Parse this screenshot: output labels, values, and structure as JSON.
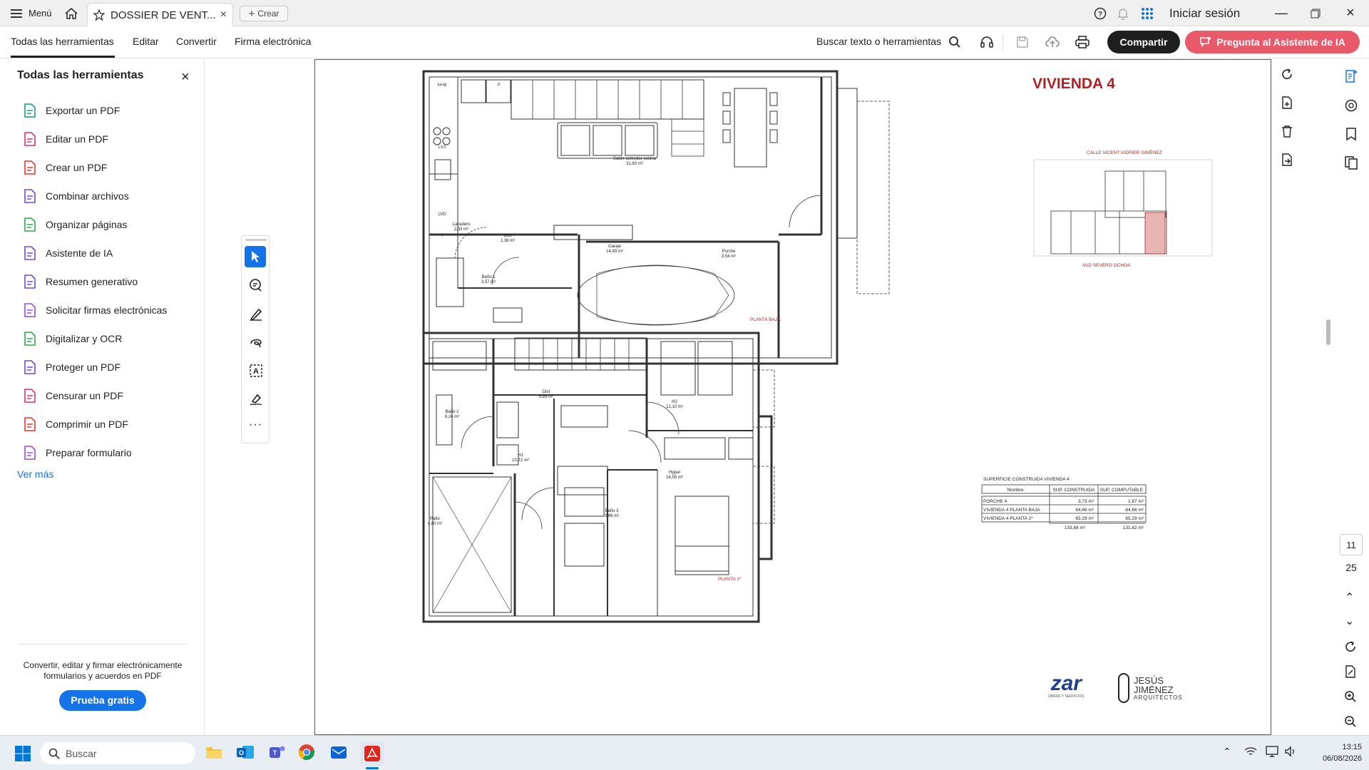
{
  "titlebar": {
    "menu_label": "Menú",
    "tab_title": "DOSSIER DE VENT...",
    "new_tab_label": "Crear",
    "signin_label": "Iniciar sesión"
  },
  "toolbar": {
    "menus": [
      "Todas las herramientas",
      "Editar",
      "Convertir",
      "Firma electrónica"
    ],
    "search_label": "Buscar texto o herramientas",
    "share_label": "Compartir",
    "ai_label": "Pregunta al Asistente de IA"
  },
  "left_panel": {
    "title": "Todas las herramientas",
    "tools": [
      {
        "label": "Exportar un PDF",
        "color": "#1a9c8a"
      },
      {
        "label": "Editar un PDF",
        "color": "#d6336c"
      },
      {
        "label": "Crear un PDF",
        "color": "#e03c31"
      },
      {
        "label": "Combinar archivos",
        "color": "#6b4bd8"
      },
      {
        "label": "Organizar páginas",
        "color": "#2fa84f"
      },
      {
        "label": "Asistente de IA",
        "color": "#6b4bd8"
      },
      {
        "label": "Resumen generativo",
        "color": "#6b4bd8"
      },
      {
        "label": "Solicitar firmas electrónicas",
        "color": "#9b4bd8"
      },
      {
        "label": "Digitalizar y OCR",
        "color": "#2fa84f"
      },
      {
        "label": "Proteger un PDF",
        "color": "#6b4bd8"
      },
      {
        "label": "Censurar un PDF",
        "color": "#d6336c"
      },
      {
        "label": "Comprimir un PDF",
        "color": "#e03c31"
      },
      {
        "label": "Preparar formulario",
        "color": "#9b4bd8"
      }
    ],
    "see_more": "Ver más",
    "promo_text": "Convertir, editar y firmar electrónicamente formularios y acuerdos en PDF",
    "trial_label": "Prueba gratis"
  },
  "document": {
    "title": "VIVIENDA 4",
    "street_top": "CALLE VICENT VIDRIER GIMÉNEZ",
    "street_bottom": "AVD SEVERO OCHOA",
    "ground_floor_label": "PLANTA BAJA",
    "first_floor_label": "PLANTA 1º",
    "rooms_ground": [
      {
        "name": "Salón-comedor-cocina",
        "area": "31,63 m²"
      },
      {
        "name": "Lavadero",
        "area": "2,33 m²"
      },
      {
        "name": "Dist",
        "area": "1,38 m²"
      },
      {
        "name": "Garaje",
        "area": "14,49 m²"
      },
      {
        "name": "Porche",
        "area": "3,54 m²"
      },
      {
        "name": "Baño 1",
        "area": "3,57 m²"
      }
    ],
    "rooms_first": [
      {
        "name": "Dist",
        "area": "5,85 m²"
      },
      {
        "name": "H2",
        "area": "12,10 m²"
      },
      {
        "name": "Baño 2",
        "area": "6,24 m²"
      },
      {
        "name": "H1",
        "area": "10,72 m²"
      },
      {
        "name": "Hppal",
        "area": "14,55 m²"
      },
      {
        "name": "Patio",
        "area": "4,80 m²"
      },
      {
        "name": "Baño 3",
        "area": "3,66 m²"
      }
    ],
    "fixture_labels": [
      "H+M",
      "F",
      "LVJ",
      "LVD",
      "T"
    ],
    "area_table": {
      "title": "SUPERFICIE CONSTRUIDA VIVIENDA 4",
      "headers": [
        "Nombre",
        "SUP. CONSTRUIDA",
        "SUP. COMPUTABLE"
      ],
      "rows": [
        [
          "PORCHE 4",
          "3,73 m²",
          "1,87 m²"
        ],
        [
          "VIVIENDA 4 PLANTA BAJA",
          "64,66 m²",
          "64,66 m²"
        ],
        [
          "VIVIENDA 4 PLANTA 1º",
          "65,29 m²",
          "65,29 m²"
        ]
      ],
      "totals": [
        "133,68 m²",
        "131,82 m²"
      ]
    },
    "logo_zar": "zar",
    "logo_zar_sub": "OBRAS Y SERVICIOS",
    "logo_jj": "JESÚS JIMÉNEZ",
    "logo_jj_sub": "ARQUITECTOS",
    "accent_color": "#b22222"
  },
  "page_nav": {
    "current_page": "11",
    "total_pages": "25"
  },
  "taskbar": {
    "search_placeholder": "Buscar",
    "time": "13:15",
    "date": "06/08/2026"
  }
}
